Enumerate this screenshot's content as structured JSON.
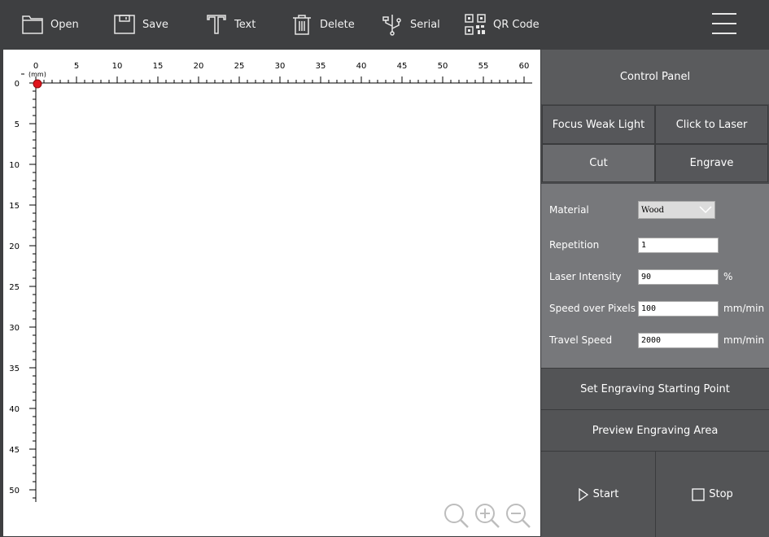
{
  "toolbar": {
    "open_label": "Open",
    "save_label": "Save",
    "text_label": "Text",
    "delete_label": "Delete",
    "serial_label": "Serial",
    "qr_label": "QR Code"
  },
  "ruler": {
    "unit": "(mm)",
    "x_ticks": [
      "0",
      "5",
      "10",
      "15",
      "20",
      "25",
      "30",
      "35",
      "40",
      "45",
      "50",
      "55",
      "60"
    ],
    "y_ticks": [
      "0",
      "5",
      "10",
      "15",
      "20",
      "25",
      "30",
      "35",
      "40",
      "45",
      "50"
    ]
  },
  "panel": {
    "title": "Control Panel",
    "focus_label": "Focus Weak Light",
    "click_laser_label": "Click to Laser",
    "cut_label": "Cut",
    "engrave_label": "Engrave",
    "settings": {
      "material_label": "Material",
      "material_value": "Wood",
      "repetition_label": "Repetition",
      "repetition_value": "1",
      "intensity_label": "Laser Intensity",
      "intensity_value": "90",
      "intensity_unit": "%",
      "speed_pixels_label": "Speed over Pixels",
      "speed_pixels_value": "100",
      "speed_pixels_unit": "mm/min",
      "travel_label": "Travel Speed",
      "travel_value": "2000",
      "travel_unit": "mm/min"
    },
    "set_start_label": "Set Engraving Starting Point",
    "preview_label": "Preview Engraving Area",
    "start_label": "Start",
    "stop_label": "Stop"
  },
  "colors": {
    "origin_marker": "#e0141c",
    "toolbar_bg": "#3e3f41",
    "settings_bg": "#77787b"
  }
}
